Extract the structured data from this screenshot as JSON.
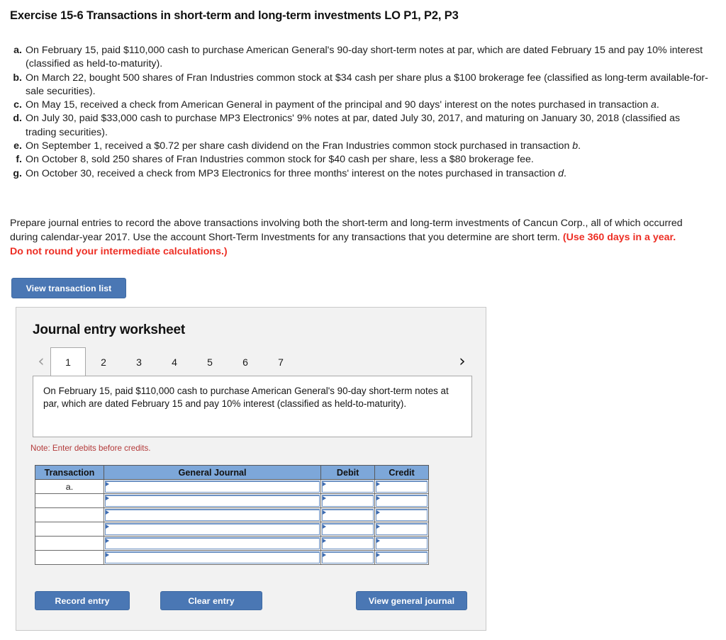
{
  "exercise": {
    "title": "Exercise 15-6 Transactions in short-term and long-term investments LO P1, P2, P3"
  },
  "transactions": [
    {
      "letter": "a.",
      "text": "On February 15, paid $110,000 cash to purchase American General's 90-day short-term notes at par, which are dated February 15 and pay 10% interest (classified as held-to-maturity)."
    },
    {
      "letter": "b.",
      "text": "On March 22, bought 500 shares of Fran Industries common stock at $34 cash per share plus a $100 brokerage fee (classified as long-term available-for-sale securities)."
    },
    {
      "letter": "c.",
      "text": "On May 15, received a check from American General in payment of the principal and 90 days' interest on the notes purchased in transaction a."
    },
    {
      "letter": "d.",
      "text": "On July 30, paid $33,000 cash to purchase MP3 Electronics' 9% notes at par, dated July 30, 2017, and maturing on January 30, 2018 (classified as trading securities)."
    },
    {
      "letter": "e.",
      "text": "On September 1, received a $0.72 per share cash dividend on the Fran Industries common stock purchased in transaction b."
    },
    {
      "letter": "f.",
      "text": "On October 8, sold 250 shares of Fran Industries common stock for $40 cash per share, less a $80 brokerage fee."
    },
    {
      "letter": "g.",
      "text": "On October 30, received a check from MP3 Electronics for three months' interest on the notes purchased in transaction d."
    }
  ],
  "prompt": {
    "body": "Prepare journal entries to record the above transactions involving both the short-term and long-term investments of Cancun Corp., all of which occurred during calendar-year 2017. Use the account Short-Term Investments for any transactions that you determine are short term. ",
    "red_note": "(Use 360 days in a year. Do not round your intermediate calculations.)"
  },
  "buttons": {
    "view_transaction_list": "View transaction list",
    "record_entry": "Record entry",
    "clear_entry": "Clear entry",
    "view_general_journal": "View general journal"
  },
  "worksheet": {
    "title": "Journal entry worksheet",
    "prev_icon": "chevron-left-icon",
    "next_icon": "chevron-right-icon",
    "prev_glyph": "‹",
    "next_glyph": "›",
    "tabs": [
      "1",
      "2",
      "3",
      "4",
      "5",
      "6",
      "7"
    ],
    "active_tab": "1",
    "description": "On February 15, paid $110,000 cash to purchase American General's 90-day short-term notes at par, which are dated February 15 and pay 10% interest (classified as held-to-maturity).",
    "note": "Note: Enter debits before credits."
  },
  "journal_table": {
    "headers": [
      "Transaction",
      "General Journal",
      "Debit",
      "Credit"
    ],
    "rows": [
      {
        "transaction": "a.",
        "general_journal": "",
        "debit": "",
        "credit": ""
      },
      {
        "transaction": "",
        "general_journal": "",
        "debit": "",
        "credit": ""
      },
      {
        "transaction": "",
        "general_journal": "",
        "debit": "",
        "credit": ""
      },
      {
        "transaction": "",
        "general_journal": "",
        "debit": "",
        "credit": ""
      },
      {
        "transaction": "",
        "general_journal": "",
        "debit": "",
        "credit": ""
      },
      {
        "transaction": "",
        "general_journal": "",
        "debit": "",
        "credit": ""
      }
    ]
  },
  "colors": {
    "button_blue": "#4a77b4",
    "table_header_blue": "#7da7d9",
    "red_note": "#ed2e24",
    "note_red": "#b33a3a",
    "panel_gray": "#f2f2f2"
  }
}
